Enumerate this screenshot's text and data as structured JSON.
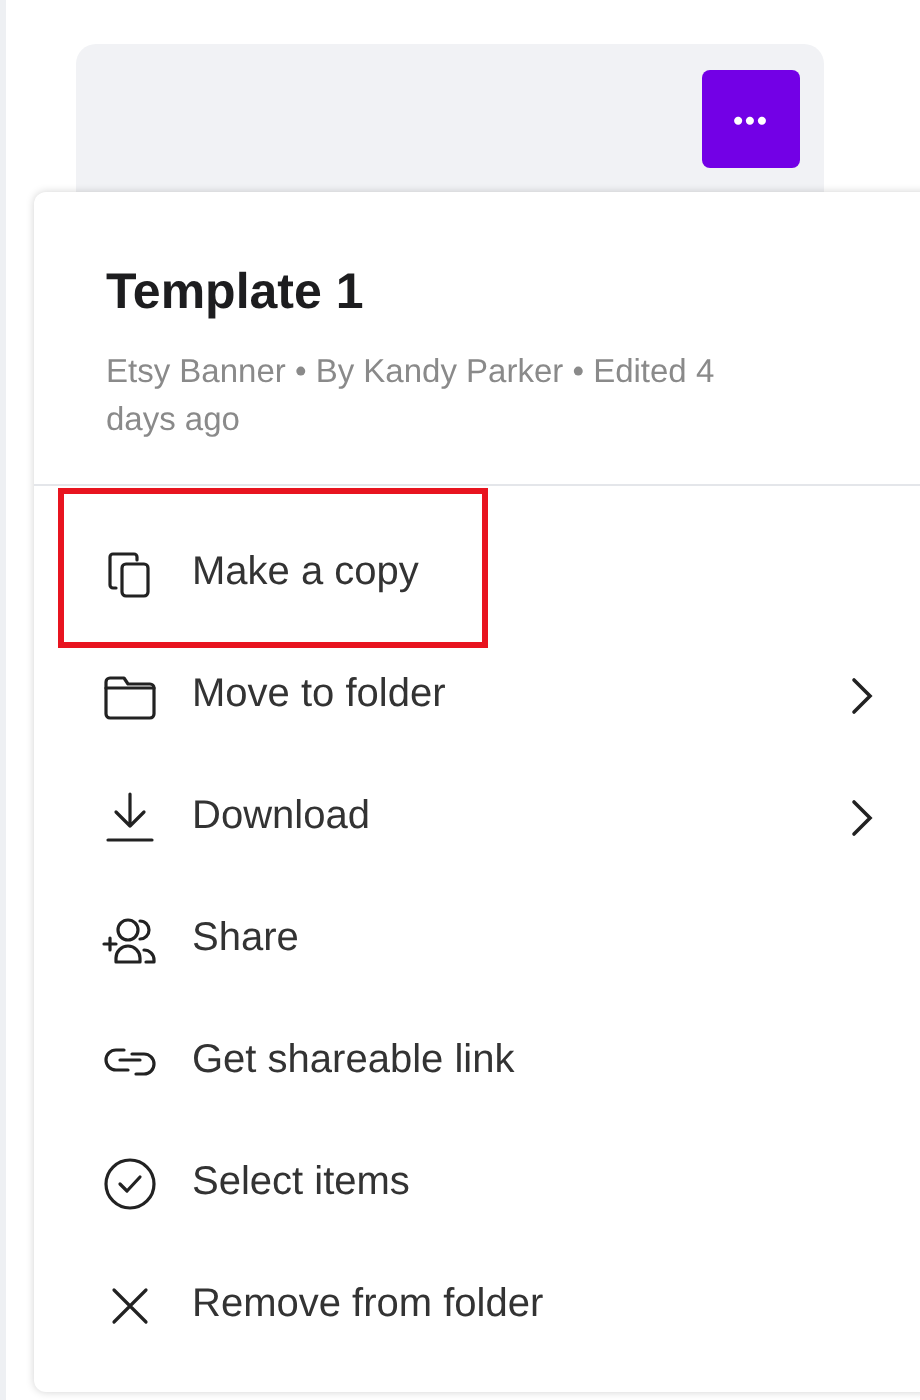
{
  "card": {
    "more_button": "•••"
  },
  "menu": {
    "title": "Template 1",
    "subtitle": "Etsy Banner • By Kandy Parker • Edited 4 days ago",
    "items": [
      {
        "label": "Make a copy",
        "has_submenu": false,
        "highlighted": true
      },
      {
        "label": "Move to folder",
        "has_submenu": true,
        "highlighted": false
      },
      {
        "label": "Download",
        "has_submenu": true,
        "highlighted": false
      },
      {
        "label": "Share",
        "has_submenu": false,
        "highlighted": false
      },
      {
        "label": "Get shareable link",
        "has_submenu": false,
        "highlighted": false
      },
      {
        "label": "Select items",
        "has_submenu": false,
        "highlighted": false
      },
      {
        "label": "Remove from folder",
        "has_submenu": false,
        "highlighted": false
      }
    ]
  }
}
